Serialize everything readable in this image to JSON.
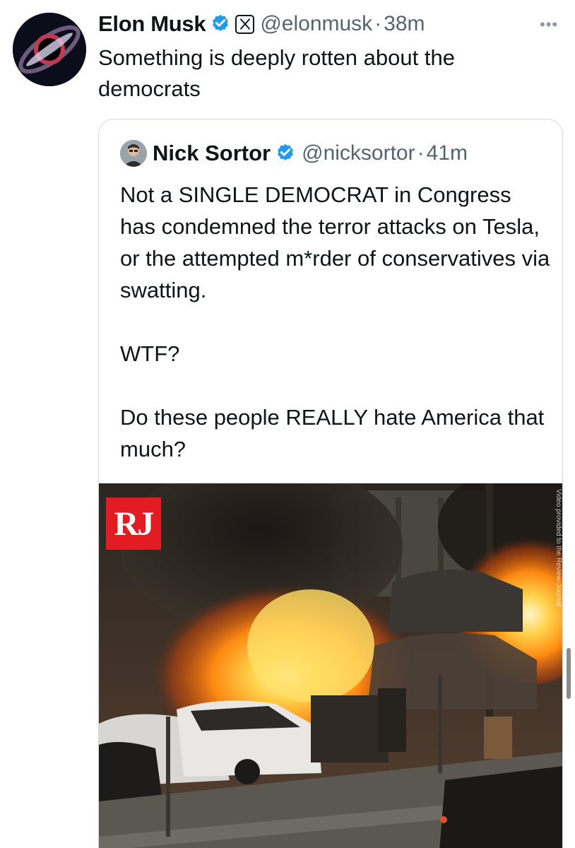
{
  "tweet": {
    "author_name": "Elon Musk",
    "handle": "@elonmusk",
    "separator": "·",
    "time": "38m",
    "more": "•••",
    "text": "Something is deeply rotten about the democrats"
  },
  "quoted_tweet": {
    "author_name": "Nick Sortor",
    "handle": "@nicksortor",
    "separator": "·",
    "time": "41m",
    "text": "Not a SINGLE DEMOCRAT in Congress has condemned the terror attacks on Tesla, or the attempted m*rder of conservatives via swatting.\n\nWTF?\n\nDo these people REALLY hate America that much?",
    "media": {
      "logo": "RJ",
      "watermark": "Video provided to the Review-Journal"
    }
  },
  "icons": [
    "verified-badge-icon",
    "x-logo-icon",
    "more-options-icon"
  ],
  "colors": {
    "verified_blue": "#1d9bf0",
    "secondary_text": "#536471",
    "border": "#cfd9de",
    "rj_red": "#e31b23"
  }
}
